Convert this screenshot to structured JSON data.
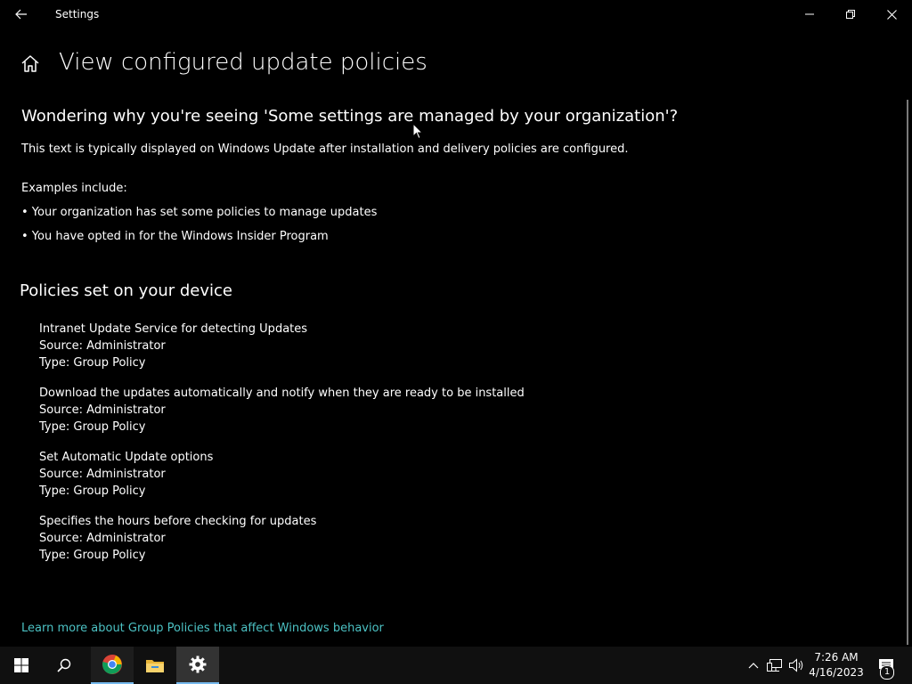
{
  "window": {
    "title": "Settings"
  },
  "page": {
    "title": "View configured update policies",
    "question": "Wondering why you're seeing 'Some settings are managed by your organization'?",
    "description": "This text is typically displayed on Windows Update after installation and delivery policies are configured.",
    "examples_label": "Examples include:",
    "examples": [
      "• Your organization has set some policies to manage updates",
      "• You have opted in for the Windows Insider Program"
    ],
    "section_title": "Policies set on your device",
    "policies": [
      {
        "name": "Intranet Update Service for detecting Updates",
        "source": "Source: Administrator",
        "type": "Type: Group Policy"
      },
      {
        "name": "Download the updates automatically and notify when they are ready to be installed",
        "source": "Source: Administrator",
        "type": "Type: Group Policy"
      },
      {
        "name": "Set Automatic Update options",
        "source": "Source: Administrator",
        "type": "Type: Group Policy"
      },
      {
        "name": "Specifies the hours before checking for updates",
        "source": "Source: Administrator",
        "type": "Type: Group Policy"
      }
    ],
    "learn_more": "Learn more about Group Policies that affect Windows behavior"
  },
  "taskbar": {
    "time": "7:26 AM",
    "date": "4/16/2023",
    "notification_count": "1"
  },
  "colors": {
    "background": "#000000",
    "link": "#4cc2c4",
    "taskbar": "#101010",
    "accent": "#76b9ed"
  },
  "icons": {
    "back": "back-arrow-icon",
    "home": "home-icon",
    "minimize": "minimize-icon",
    "restore": "restore-icon",
    "close": "close-icon",
    "start": "windows-logo-icon",
    "search": "search-icon",
    "chrome": "chrome-icon",
    "explorer": "folder-icon",
    "settings": "gear-icon",
    "tray_chevron": "chevron-up-icon",
    "network": "network-icon",
    "volume": "volume-icon",
    "notifications": "notification-icon"
  }
}
